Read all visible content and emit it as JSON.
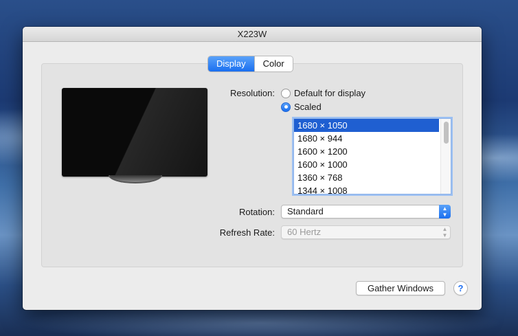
{
  "window": {
    "title": "X223W"
  },
  "tabs": [
    {
      "label": "Display",
      "active": true
    },
    {
      "label": "Color",
      "active": false
    }
  ],
  "resolution": {
    "label": "Resolution:",
    "options": [
      {
        "label": "Default for display",
        "selected": false
      },
      {
        "label": "Scaled",
        "selected": true
      }
    ],
    "list": [
      "1680 × 1050",
      "1680 × 944",
      "1600 × 1200",
      "1600 × 1000",
      "1360 × 768",
      "1344 × 1008"
    ],
    "selected_index": 0
  },
  "rotation": {
    "label": "Rotation:",
    "value": "Standard"
  },
  "refresh_rate": {
    "label": "Refresh Rate:",
    "value": "60 Hertz",
    "enabled": false
  },
  "buttons": {
    "gather": "Gather Windows",
    "help": "?"
  },
  "colors": {
    "accent": "#1a6ff0",
    "selection": "#1f5fd1"
  }
}
